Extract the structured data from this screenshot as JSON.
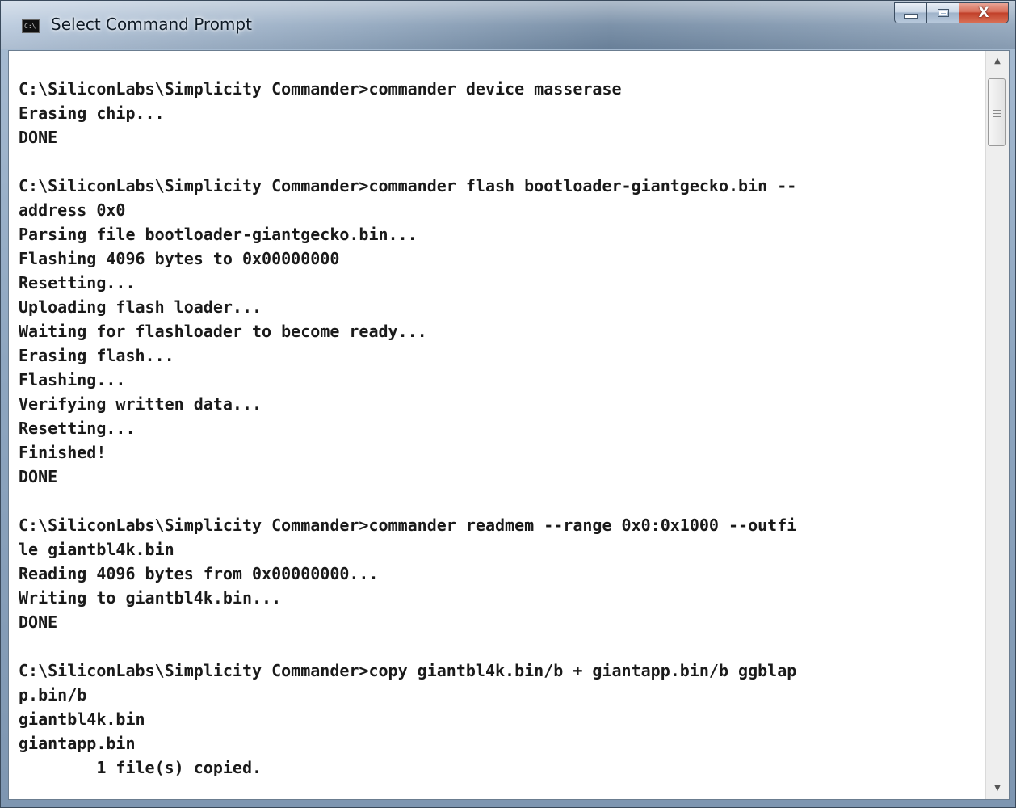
{
  "window": {
    "title": "Select Command Prompt",
    "icon": "cmd-icon",
    "icon_text": "C:\\",
    "controls": {
      "minimize_icon": "minimize-icon",
      "maximize_icon": "maximize-icon",
      "close_icon": "close-icon",
      "close_glyph": "X"
    }
  },
  "console": {
    "lines": [
      "C:\\SiliconLabs\\Simplicity Commander>commander device masserase",
      "Erasing chip...",
      "DONE",
      "",
      "C:\\SiliconLabs\\Simplicity Commander>commander flash bootloader-giantgecko.bin --",
      "address 0x0",
      "Parsing file bootloader-giantgecko.bin...",
      "Flashing 4096 bytes to 0x00000000",
      "Resetting...",
      "Uploading flash loader...",
      "Waiting for flashloader to become ready...",
      "Erasing flash...",
      "Flashing...",
      "Verifying written data...",
      "Resetting...",
      "Finished!",
      "DONE",
      "",
      "C:\\SiliconLabs\\Simplicity Commander>commander readmem --range 0x0:0x1000 --outfi",
      "le giantbl4k.bin",
      "Reading 4096 bytes from 0x00000000...",
      "Writing to giantbl4k.bin...",
      "DONE",
      "",
      "C:\\SiliconLabs\\Simplicity Commander>copy giantbl4k.bin/b + giantapp.bin/b ggblap",
      "p.bin/b",
      "giantbl4k.bin",
      "giantapp.bin",
      "        1 file(s) copied."
    ]
  },
  "scrollbar": {
    "up_icon": "scroll-up-arrow-icon",
    "down_icon": "scroll-down-arrow-icon",
    "up_glyph": "▲",
    "down_glyph": "▼"
  },
  "colors": {
    "console_text": "#1a1a1a",
    "console_background": "#ffffff",
    "close_button": "#c7432b"
  }
}
